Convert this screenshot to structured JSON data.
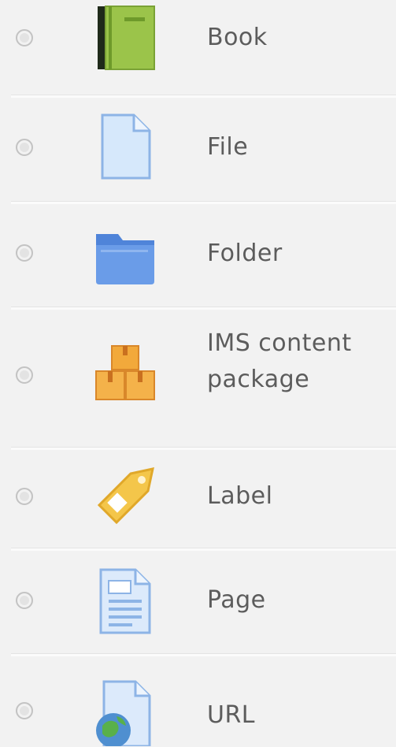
{
  "activities": [
    {
      "label": "Book",
      "icon": "book-icon"
    },
    {
      "label": "File",
      "icon": "file-icon"
    },
    {
      "label": "Folder",
      "icon": "folder-icon"
    },
    {
      "label": "IMS content\npackage",
      "icon": "ims-package-icon"
    },
    {
      "label": "Label",
      "icon": "label-tag-icon"
    },
    {
      "label": "Page",
      "icon": "page-icon"
    },
    {
      "label": "URL",
      "icon": "url-globe-icon"
    }
  ],
  "colors": {
    "background": "#f2f2f2",
    "book_green": "#9bc44a",
    "folder_blue": "#5b8fe0",
    "file_blue": "#cfe3f8",
    "package_orange": "#f2a93b",
    "label_yellow": "#f4c64a"
  }
}
